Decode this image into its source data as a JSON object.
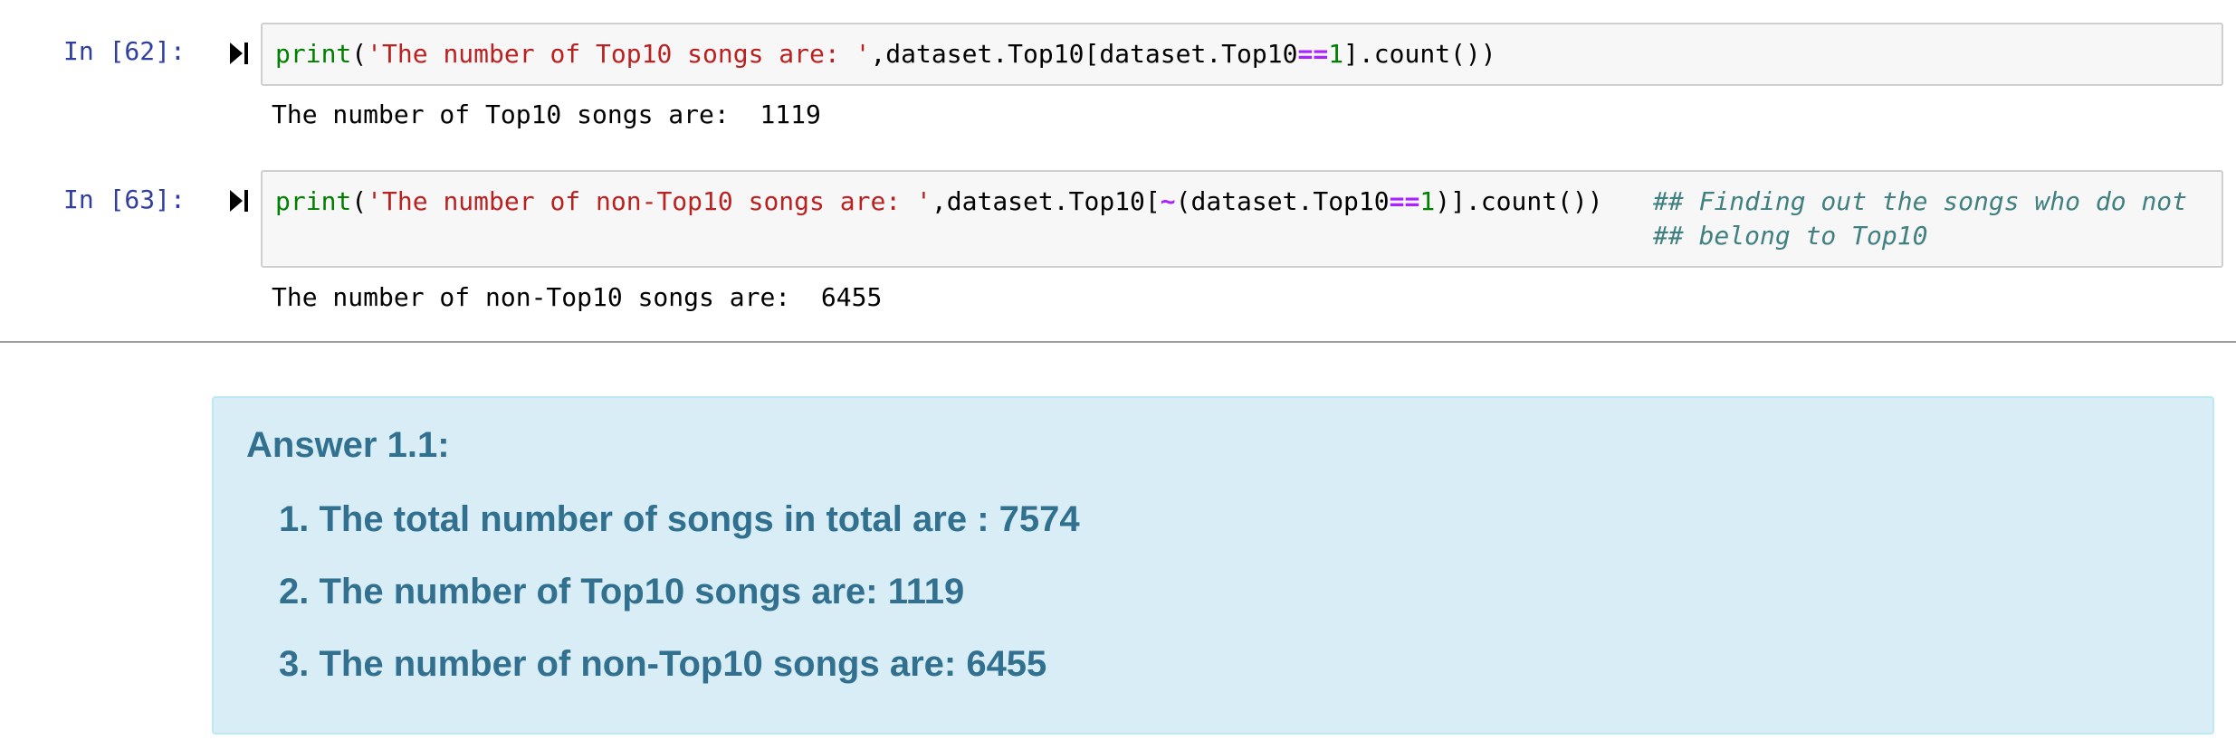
{
  "cells": [
    {
      "prompt": "In [62]:",
      "code": {
        "func": "print",
        "open": "(",
        "string": "'The number of Top10 songs are: '",
        "rest_a": ",dataset.Top10[dataset.Top10",
        "op": "==",
        "num": "1",
        "rest_b": "].count())"
      },
      "output": "The number of Top10 songs are:  1119"
    },
    {
      "prompt": "In [63]:",
      "code": {
        "func": "print",
        "open": "(",
        "string": "'The number of non-Top10 songs are: '",
        "rest_a": ",dataset.Top10[",
        "tilde": "~",
        "rest_b": "(dataset.Top10",
        "op": "==",
        "num": "1",
        "rest_c": ")].count())",
        "comment_1": "## Finding out the songs who do not",
        "comment_2": "## belong to Top10"
      },
      "output": "The number of non-Top10 songs are:  6455"
    }
  ],
  "answer": {
    "title": "Answer 1.1:",
    "items": [
      "1. The total number of songs in total are : 7574",
      "2. The number of Top10 songs are: 1119",
      "3. The number of non-Top10 songs are: 6455"
    ]
  },
  "colors": {
    "prompt": "#303f9f",
    "string": "#ba2121",
    "keyword": "#008000",
    "operator": "#aa22ff",
    "comment": "#408080",
    "answer_bg": "#d9edf7",
    "answer_text": "#31708f"
  },
  "icons": {
    "run": "run-cell-icon"
  }
}
